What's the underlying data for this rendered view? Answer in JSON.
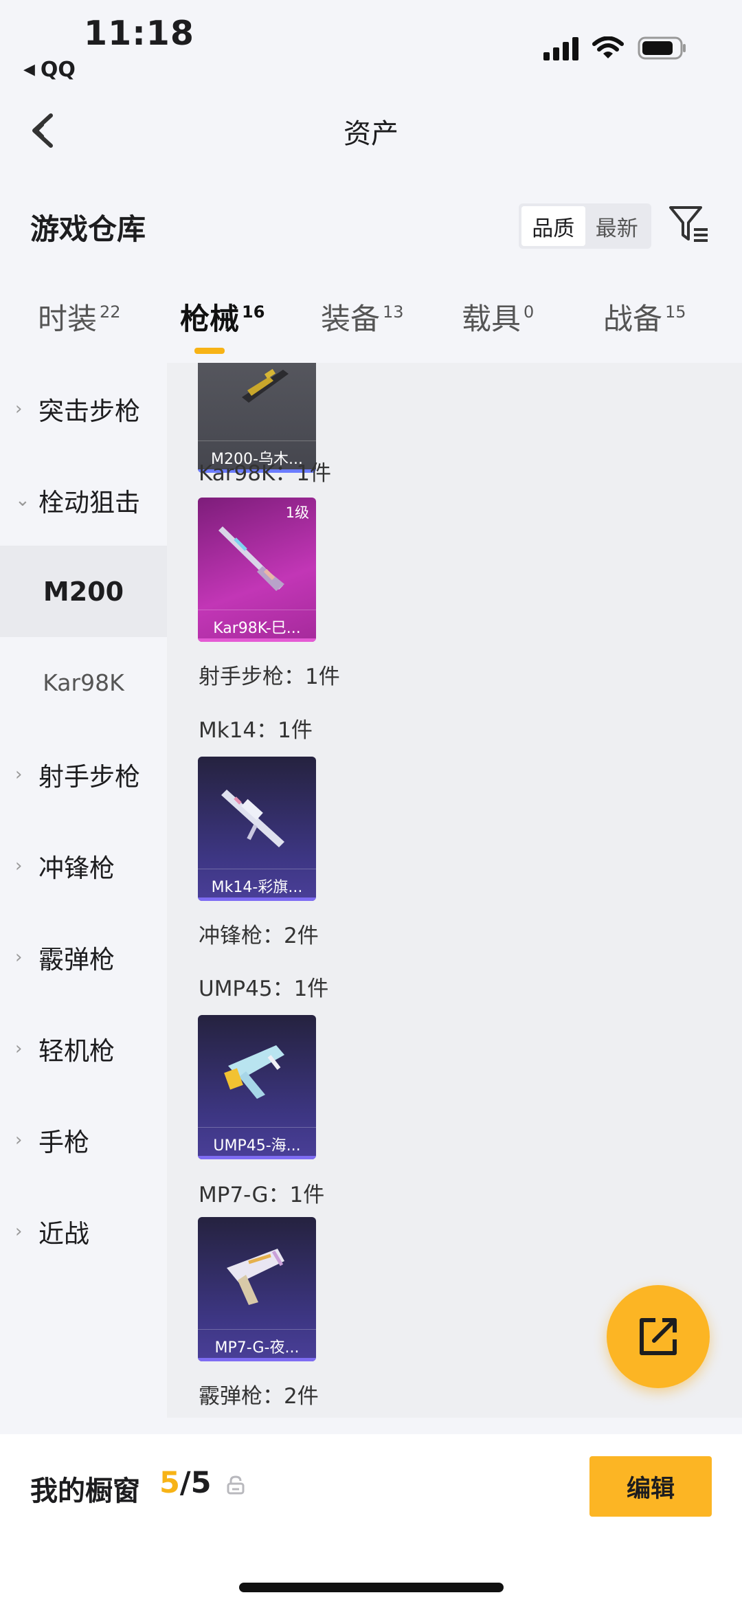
{
  "status_bar": {
    "time": "11:18",
    "back_app": "QQ"
  },
  "nav": {
    "title": "资产"
  },
  "warehouse": {
    "title": "游戏仓库"
  },
  "sort": {
    "quality": "品质",
    "newest": "最新",
    "active": "quality"
  },
  "tabs": [
    {
      "label": "时装",
      "count": "22"
    },
    {
      "label": "枪械",
      "count": "16",
      "active": true
    },
    {
      "label": "装备",
      "count": "13"
    },
    {
      "label": "载具",
      "count": "0"
    },
    {
      "label": "战备",
      "count": "15"
    }
  ],
  "sidebar": [
    {
      "label": "突击步枪",
      "type": "collapsed"
    },
    {
      "label": "栓动狙击",
      "type": "expanded"
    },
    {
      "label": "M200",
      "type": "selected"
    },
    {
      "label": "Kar98K",
      "type": "sub"
    },
    {
      "label": "射手步枪",
      "type": "collapsed"
    },
    {
      "label": "冲锋枪",
      "type": "collapsed"
    },
    {
      "label": "霰弹枪",
      "type": "collapsed"
    },
    {
      "label": "轻机枪",
      "type": "collapsed"
    },
    {
      "label": "手枪",
      "type": "collapsed"
    },
    {
      "label": "近战",
      "type": "collapsed"
    }
  ],
  "content": {
    "labels": {
      "kar98k": "Kar98K：1件",
      "marksman": "射手步枪：1件",
      "mk14": "Mk14：1件",
      "smg": "冲锋枪：2件",
      "ump45": "UMP45：1件",
      "mp7g": "MP7-G：1件",
      "shotgun": "霰弹枪：2件"
    },
    "cards": {
      "m200": {
        "name": "M200-乌木...",
        "color": "#4c4d56"
      },
      "kar98k": {
        "name": "Kar98K-巳...",
        "level": "1级",
        "color": "#b22ba6"
      },
      "mk14": {
        "name": "Mk14-彩旗...",
        "color": "#3a3476"
      },
      "ump45": {
        "name": "UMP45-海...",
        "color": "#3a3476"
      },
      "mp7g": {
        "name": "MP7-G-夜...",
        "color": "#3a3476"
      }
    }
  },
  "bottom_bar": {
    "label": "我的橱窗",
    "current": "5",
    "total": "/5",
    "edit": "编辑"
  },
  "colors": {
    "accent": "#fcb524",
    "bg": "#f4f5f9"
  }
}
